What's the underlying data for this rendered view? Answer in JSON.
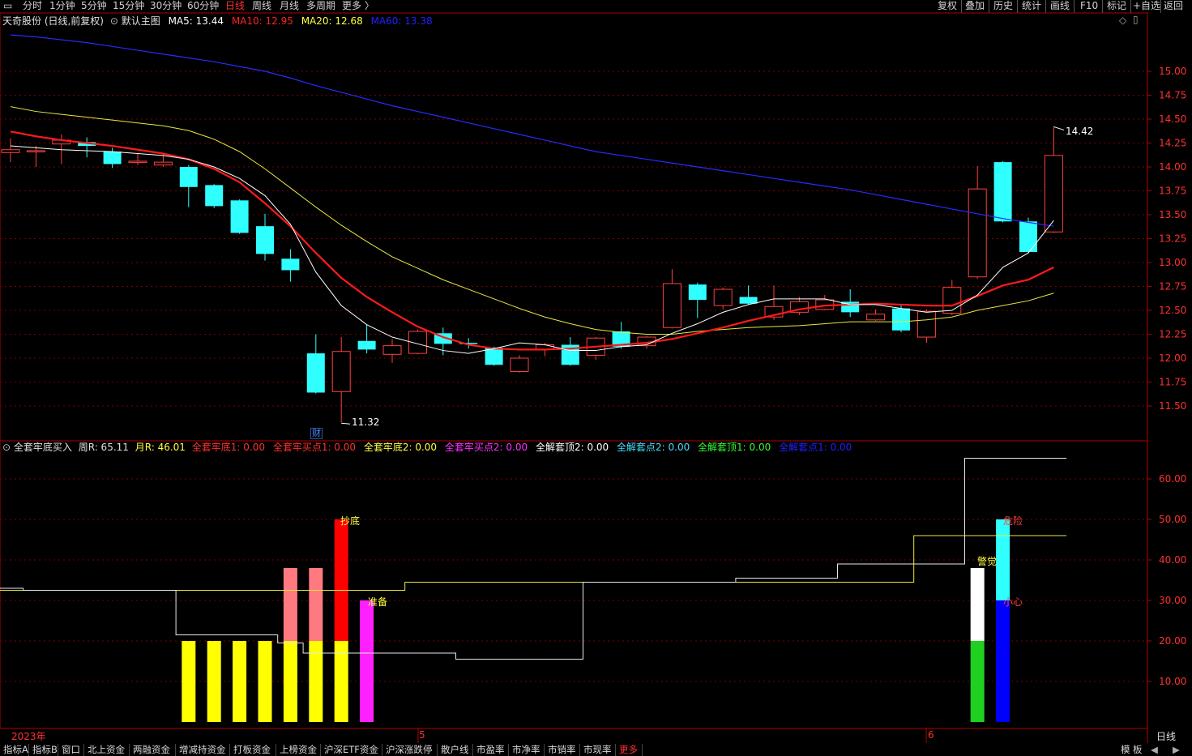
{
  "toolbar": {
    "periods": [
      "分时",
      "1分钟",
      "5分钟",
      "15分钟",
      "30分钟",
      "60分钟",
      "日线",
      "周线",
      "月线",
      "多周期",
      "更多 〉"
    ],
    "active_period": "日线",
    "right_buttons": [
      "复权",
      "叠加",
      "历史",
      "统计",
      "画线",
      "F10",
      "标记",
      "+自选",
      "返回"
    ]
  },
  "main_chart": {
    "stock_title": "天奇股份 (日线,前复权)",
    "template": "默认主图",
    "ma_legend": [
      {
        "label": "MA5: 13.44",
        "color": "#ffffff"
      },
      {
        "label": "MA10: 12.95",
        "color": "#ff2020"
      },
      {
        "label": "MA20: 12.68",
        "color": "#ffff40"
      },
      {
        "label": "MA60: 13.38",
        "color": "#2020ff"
      }
    ],
    "max_label": "14.42",
    "min_label": "11.32",
    "fin_marker": "财"
  },
  "indicator": {
    "name": "全套牢底买入",
    "legend": [
      {
        "label": "周R: 65.11",
        "color": "#e0e0e0"
      },
      {
        "label": "月R: 46.01",
        "color": "#ffff40"
      },
      {
        "label": "全套牢底1: 0.00",
        "color": "#ff3030"
      },
      {
        "label": "全套牢买点1: 0.00",
        "color": "#ff3030"
      },
      {
        "label": "全套牢底2: 0.00",
        "color": "#ffff40"
      },
      {
        "label": "全套牢买点2: 0.00",
        "color": "#ff30ff"
      },
      {
        "label": "全解套顶2: 0.00",
        "color": "#ffffff"
      },
      {
        "label": "全解套点2: 0.00",
        "color": "#40e0ff"
      },
      {
        "label": "全解套顶1: 0.00",
        "color": "#30ff30"
      },
      {
        "label": "全解套点1: 0.00",
        "color": "#2020ff"
      }
    ],
    "signals": {
      "chaodi": "抄底",
      "zhunbei": "准备",
      "jingjue": "警觉",
      "weixian": "危险",
      "xiaoxin": "小心"
    }
  },
  "x_axis": {
    "year": "2023年",
    "m5": "5",
    "m6": "6",
    "period": "日线"
  },
  "bottom_tabs": [
    "指标A",
    "指标B",
    "窗口",
    "北上资金",
    "两融资金",
    "增减持资金",
    "打板资金",
    "上榜资金",
    "沪深ETF资金",
    "沪深涨跌停",
    "散户线",
    "市盈率",
    "市净率",
    "市销率",
    "市现率",
    "更多"
  ],
  "bottom_right": [
    "模",
    "板"
  ],
  "chart_data": [
    {
      "type": "candlestick",
      "title": "天奇股份 (日线,前复权)",
      "y_ticks": [
        "15.00",
        "14.75",
        "14.50",
        "14.25",
        "14.00",
        "13.75",
        "13.50",
        "13.25",
        "13.00",
        "12.75",
        "12.50",
        "12.25",
        "12.00",
        "11.75",
        "11.50"
      ],
      "ylim": [
        11.3,
        15.4
      ],
      "candles": [
        {
          "o": 14.15,
          "c": 14.18,
          "h": 14.3,
          "l": 14.05
        },
        {
          "o": 14.17,
          "c": 14.17,
          "h": 14.22,
          "l": 14.0
        },
        {
          "o": 14.24,
          "c": 14.28,
          "h": 14.34,
          "l": 14.03
        },
        {
          "o": 14.26,
          "c": 14.22,
          "h": 14.31,
          "l": 14.1
        },
        {
          "o": 14.16,
          "c": 14.03,
          "h": 14.2,
          "l": 13.99
        },
        {
          "o": 14.06,
          "c": 14.06,
          "h": 14.14,
          "l": 14.02
        },
        {
          "o": 14.02,
          "c": 14.05,
          "h": 14.14,
          "l": 14.0
        },
        {
          "o": 14.0,
          "c": 13.79,
          "h": 14.02,
          "l": 13.58
        },
        {
          "o": 13.81,
          "c": 13.59,
          "h": 13.82,
          "l": 13.57
        },
        {
          "o": 13.65,
          "c": 13.31,
          "h": 13.66,
          "l": 13.3
        },
        {
          "o": 13.38,
          "c": 13.09,
          "h": 13.51,
          "l": 13.02
        },
        {
          "o": 13.04,
          "c": 12.92,
          "h": 13.14,
          "l": 12.8
        },
        {
          "o": 12.05,
          "c": 11.64,
          "h": 12.25,
          "l": 11.63
        },
        {
          "o": 11.65,
          "c": 12.07,
          "h": 12.22,
          "l": 11.33
        },
        {
          "o": 12.18,
          "c": 12.09,
          "h": 12.35,
          "l": 12.05
        },
        {
          "o": 12.04,
          "c": 12.13,
          "h": 12.2,
          "l": 11.95
        },
        {
          "o": 12.05,
          "c": 12.28,
          "h": 12.3,
          "l": 12.04
        },
        {
          "o": 12.26,
          "c": 12.15,
          "h": 12.32,
          "l": 12.03
        },
        {
          "o": 12.16,
          "c": 12.15,
          "h": 12.21,
          "l": 12.1
        },
        {
          "o": 12.11,
          "c": 11.93,
          "h": 12.12,
          "l": 11.92
        },
        {
          "o": 11.86,
          "c": 12.0,
          "h": 12.03,
          "l": 11.85
        },
        {
          "o": 12.09,
          "c": 12.14,
          "h": 12.16,
          "l": 12.02
        },
        {
          "o": 12.14,
          "c": 11.93,
          "h": 12.22,
          "l": 11.92
        },
        {
          "o": 12.03,
          "c": 12.21,
          "h": 12.22,
          "l": 11.98
        },
        {
          "o": 12.28,
          "c": 12.12,
          "h": 12.38,
          "l": 12.1
        },
        {
          "o": 12.13,
          "c": 12.22,
          "h": 12.23,
          "l": 12.1
        },
        {
          "o": 12.32,
          "c": 12.78,
          "h": 12.93,
          "l": 12.31
        },
        {
          "o": 12.77,
          "c": 12.61,
          "h": 12.79,
          "l": 12.42
        },
        {
          "o": 12.55,
          "c": 12.72,
          "h": 12.74,
          "l": 12.51
        },
        {
          "o": 12.64,
          "c": 12.57,
          "h": 12.76,
          "l": 12.56
        },
        {
          "o": 12.43,
          "c": 12.54,
          "h": 12.76,
          "l": 12.4
        },
        {
          "o": 12.48,
          "c": 12.59,
          "h": 12.64,
          "l": 12.45
        },
        {
          "o": 12.51,
          "c": 12.61,
          "h": 12.66,
          "l": 12.5
        },
        {
          "o": 12.59,
          "c": 12.48,
          "h": 12.72,
          "l": 12.43
        },
        {
          "o": 12.4,
          "c": 12.46,
          "h": 12.51,
          "l": 12.39
        },
        {
          "o": 12.52,
          "c": 12.29,
          "h": 12.56,
          "l": 12.27
        },
        {
          "o": 12.22,
          "c": 12.49,
          "h": 12.51,
          "l": 12.16
        },
        {
          "o": 12.47,
          "c": 12.74,
          "h": 12.82,
          "l": 12.45
        },
        {
          "o": 12.85,
          "c": 13.77,
          "h": 14.01,
          "l": 12.83
        },
        {
          "o": 14.05,
          "c": 13.43,
          "h": 14.06,
          "l": 13.42
        },
        {
          "o": 13.43,
          "c": 13.11,
          "h": 13.47,
          "l": 13.1
        },
        {
          "o": 13.32,
          "c": 14.12,
          "h": 14.42,
          "l": 13.31
        }
      ],
      "ma5": [
        14.22,
        14.2,
        14.18,
        14.17,
        14.16,
        14.14,
        14.12,
        14.08,
        14.0,
        13.88,
        13.7,
        13.4,
        12.9,
        12.55,
        12.35,
        12.22,
        12.15,
        12.08,
        12.05,
        12.1,
        12.16,
        12.14,
        12.08,
        12.08,
        12.12,
        12.14,
        12.26,
        12.36,
        12.48,
        12.56,
        12.62,
        12.62,
        12.62,
        12.56,
        12.56,
        12.52,
        12.48,
        12.5,
        12.66,
        12.95,
        13.1,
        13.44
      ],
      "ma10": [
        14.37,
        14.32,
        14.28,
        14.25,
        14.22,
        14.18,
        14.14,
        14.08,
        13.98,
        13.84,
        13.62,
        13.38,
        13.1,
        12.84,
        12.64,
        12.48,
        12.33,
        12.22,
        12.14,
        12.1,
        12.09,
        12.09,
        12.1,
        12.12,
        12.14,
        12.16,
        12.2,
        12.26,
        12.32,
        12.39,
        12.45,
        12.51,
        12.55,
        12.56,
        12.57,
        12.56,
        12.55,
        12.55,
        12.65,
        12.76,
        12.82,
        12.95
      ],
      "ma20": [
        14.63,
        14.58,
        14.55,
        14.52,
        14.49,
        14.46,
        14.43,
        14.38,
        14.29,
        14.16,
        13.98,
        13.78,
        13.58,
        13.39,
        13.22,
        13.06,
        12.94,
        12.82,
        12.72,
        12.62,
        12.52,
        12.43,
        12.36,
        12.3,
        12.27,
        12.25,
        12.25,
        12.28,
        12.3,
        12.32,
        12.33,
        12.34,
        12.36,
        12.38,
        12.38,
        12.38,
        12.4,
        12.43,
        12.5,
        12.55,
        12.6,
        12.68
      ],
      "ma60": [
        15.38,
        15.36,
        15.33,
        15.3,
        15.26,
        15.22,
        15.18,
        15.14,
        15.1,
        15.05,
        15.0,
        14.93,
        14.85,
        14.78,
        14.71,
        14.64,
        14.58,
        14.52,
        14.46,
        14.4,
        14.34,
        14.28,
        14.22,
        14.16,
        14.12,
        14.08,
        14.04,
        14.0,
        13.96,
        13.92,
        13.88,
        13.84,
        13.8,
        13.76,
        13.71,
        13.66,
        13.61,
        13.56,
        13.51,
        13.46,
        13.42,
        13.38
      ]
    },
    {
      "type": "bar",
      "title": "全套牢底买入",
      "y_ticks": [
        "60.00",
        "50.00",
        "40.00",
        "30.00",
        "20.00",
        "10.00"
      ],
      "ylim": [
        0,
        66
      ],
      "bars": [
        {
          "i": 7,
          "segments": [
            {
              "from": 0,
              "to": 20,
              "color": "#ffff00"
            }
          ]
        },
        {
          "i": 8,
          "segments": [
            {
              "from": 0,
              "to": 20,
              "color": "#ffff00"
            }
          ]
        },
        {
          "i": 9,
          "segments": [
            {
              "from": 0,
              "to": 20,
              "color": "#ffff00"
            }
          ]
        },
        {
          "i": 10,
          "segments": [
            {
              "from": 0,
              "to": 20,
              "color": "#ffff00"
            }
          ]
        },
        {
          "i": 11,
          "segments": [
            {
              "from": 0,
              "to": 20,
              "color": "#ffff00"
            },
            {
              "from": 20,
              "to": 38,
              "color": "#ff7a80"
            }
          ]
        },
        {
          "i": 12,
          "segments": [
            {
              "from": 0,
              "to": 20,
              "color": "#ffff00"
            },
            {
              "from": 20,
              "to": 38,
              "color": "#ff7a80"
            }
          ]
        },
        {
          "i": 13,
          "segments": [
            {
              "from": 0,
              "to": 20,
              "color": "#ffff00"
            },
            {
              "from": 20,
              "to": 50,
              "color": "#ff0000"
            }
          ]
        },
        {
          "i": 14,
          "segments": [
            {
              "from": 0,
              "to": 30,
              "color": "#ff20ff"
            }
          ]
        },
        {
          "i": 38,
          "segments": [
            {
              "from": 0,
              "to": 20,
              "color": "#20d020"
            },
            {
              "from": 20,
              "to": 38,
              "color": "#ffffff"
            }
          ]
        },
        {
          "i": 39,
          "segments": [
            {
              "from": 0,
              "to": 30,
              "color": "#0000ff"
            },
            {
              "from": 30,
              "to": 50,
              "color": "#30ffff"
            }
          ]
        }
      ],
      "week_r": [
        33,
        32.5,
        32.5,
        32.5,
        32.5,
        32.5,
        32.5,
        21.5,
        21.5,
        21.5,
        21.5,
        19.5,
        17,
        17,
        17,
        17,
        17,
        17,
        15.5,
        15.5,
        15.5,
        15.5,
        15.5,
        34.5,
        34.5,
        34.5,
        34.5,
        34.5,
        34.5,
        35.5,
        35.5,
        35.5,
        35.5,
        39,
        39,
        39,
        39,
        39,
        65.11,
        65.11,
        65.11,
        65.11
      ],
      "month_r": [
        32.5,
        32.5,
        32.5,
        32.5,
        32.5,
        32.5,
        32.5,
        32.5,
        32.5,
        32.5,
        32.5,
        32.5,
        32.5,
        32.5,
        32.5,
        32.5,
        34.5,
        34.5,
        34.5,
        34.5,
        34.5,
        34.5,
        34.5,
        34.5,
        34.5,
        34.5,
        34.5,
        34.5,
        34.5,
        34.5,
        34.5,
        34.5,
        34.5,
        34.5,
        34.5,
        34.5,
        46.01,
        46.01,
        46.01,
        46.01,
        46.01,
        46.01
      ]
    }
  ]
}
